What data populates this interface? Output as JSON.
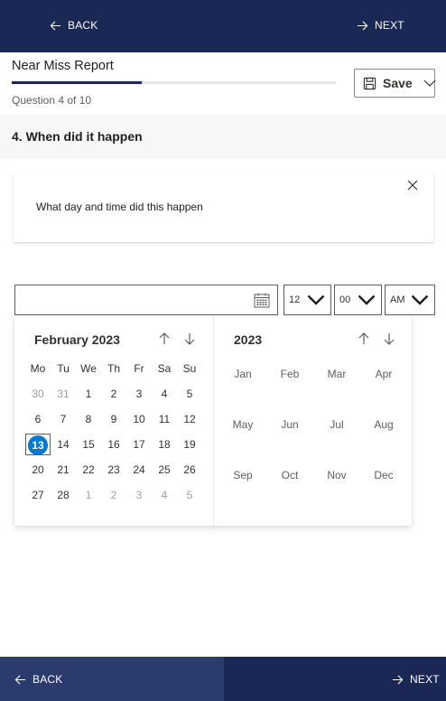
{
  "nav": {
    "back_label": "BACK",
    "next_label": "NEXT"
  },
  "header": {
    "title": "Near Miss Report",
    "progress_text": "Question 4 of 10",
    "progress_fraction": 0.4,
    "save_label": "Save"
  },
  "question": {
    "title": "4. When did it happen",
    "prompt": "What day and time did this happen"
  },
  "date_input": {
    "value": "",
    "placeholder": ""
  },
  "time": {
    "hour": "12",
    "minute": "00",
    "ampm": "AM"
  },
  "calendar": {
    "month_label": "February 2023",
    "weekdays": [
      "Mo",
      "Tu",
      "We",
      "Th",
      "Fr",
      "Sa",
      "Su"
    ],
    "weeks": [
      [
        {
          "d": "30",
          "dim": true
        },
        {
          "d": "31",
          "dim": true
        },
        {
          "d": "1"
        },
        {
          "d": "2"
        },
        {
          "d": "3"
        },
        {
          "d": "4"
        },
        {
          "d": "5"
        }
      ],
      [
        {
          "d": "6"
        },
        {
          "d": "7"
        },
        {
          "d": "8"
        },
        {
          "d": "9"
        },
        {
          "d": "10"
        },
        {
          "d": "11"
        },
        {
          "d": "12"
        }
      ],
      [
        {
          "d": "13",
          "today": true
        },
        {
          "d": "14"
        },
        {
          "d": "15"
        },
        {
          "d": "16"
        },
        {
          "d": "17"
        },
        {
          "d": "18"
        },
        {
          "d": "19"
        }
      ],
      [
        {
          "d": "20"
        },
        {
          "d": "21"
        },
        {
          "d": "22"
        },
        {
          "d": "23"
        },
        {
          "d": "24"
        },
        {
          "d": "25"
        },
        {
          "d": "26"
        }
      ],
      [
        {
          "d": "27"
        },
        {
          "d": "28"
        },
        {
          "d": "1",
          "dim": true
        },
        {
          "d": "2",
          "dim": true
        },
        {
          "d": "3",
          "dim": true
        },
        {
          "d": "4",
          "dim": true
        },
        {
          "d": "5",
          "dim": true
        }
      ]
    ],
    "year_label": "2023",
    "months": [
      "Jan",
      "Feb",
      "Mar",
      "Apr",
      "May",
      "Jun",
      "Jul",
      "Aug",
      "Sep",
      "Oct",
      "Nov",
      "Dec"
    ]
  },
  "colors": {
    "nav_bg": "#1b2754",
    "nav_back_bg": "#2c3b6e",
    "today": "#0078d4",
    "question_bg": "#f8f7f5"
  }
}
